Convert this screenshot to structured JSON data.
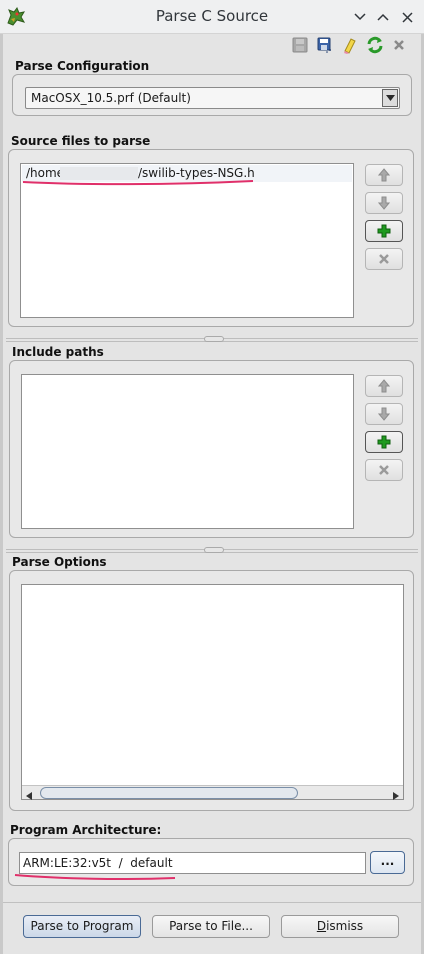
{
  "window": {
    "title": "Parse C Source",
    "controls": [
      "chevron-down-icon",
      "chevron-up-icon",
      "close-icon"
    ]
  },
  "toolbar": {
    "icons": [
      "save-disabled-icon",
      "save-as-icon",
      "clear-icon",
      "refresh-icon",
      "delete-icon"
    ]
  },
  "parse_configuration": {
    "label": "Parse Configuration",
    "selected": "MacOSX_10.5.prf (Default)"
  },
  "source_files": {
    "label": "Source files to parse",
    "items": [
      {
        "prefix": "/home",
        "suffix": "/swilib-types-NSG.h",
        "redacted": true
      }
    ]
  },
  "include_paths": {
    "label": "Include paths",
    "items": []
  },
  "parse_options": {
    "label": "Parse Options",
    "text": ""
  },
  "program_architecture": {
    "label": "Program Architecture:",
    "value": "ARM:LE:32:v5t  /  default",
    "browse_label": "..."
  },
  "buttons": {
    "parse_to_program": "Parse to Program",
    "parse_to_file": "Parse to File...",
    "dismiss_first": "D",
    "dismiss_rest": "ismiss"
  },
  "colors": {
    "underline_marker": "#e0306a",
    "add_icon": "#1f9a1f",
    "refresh_icon": "#2a9a2a"
  }
}
